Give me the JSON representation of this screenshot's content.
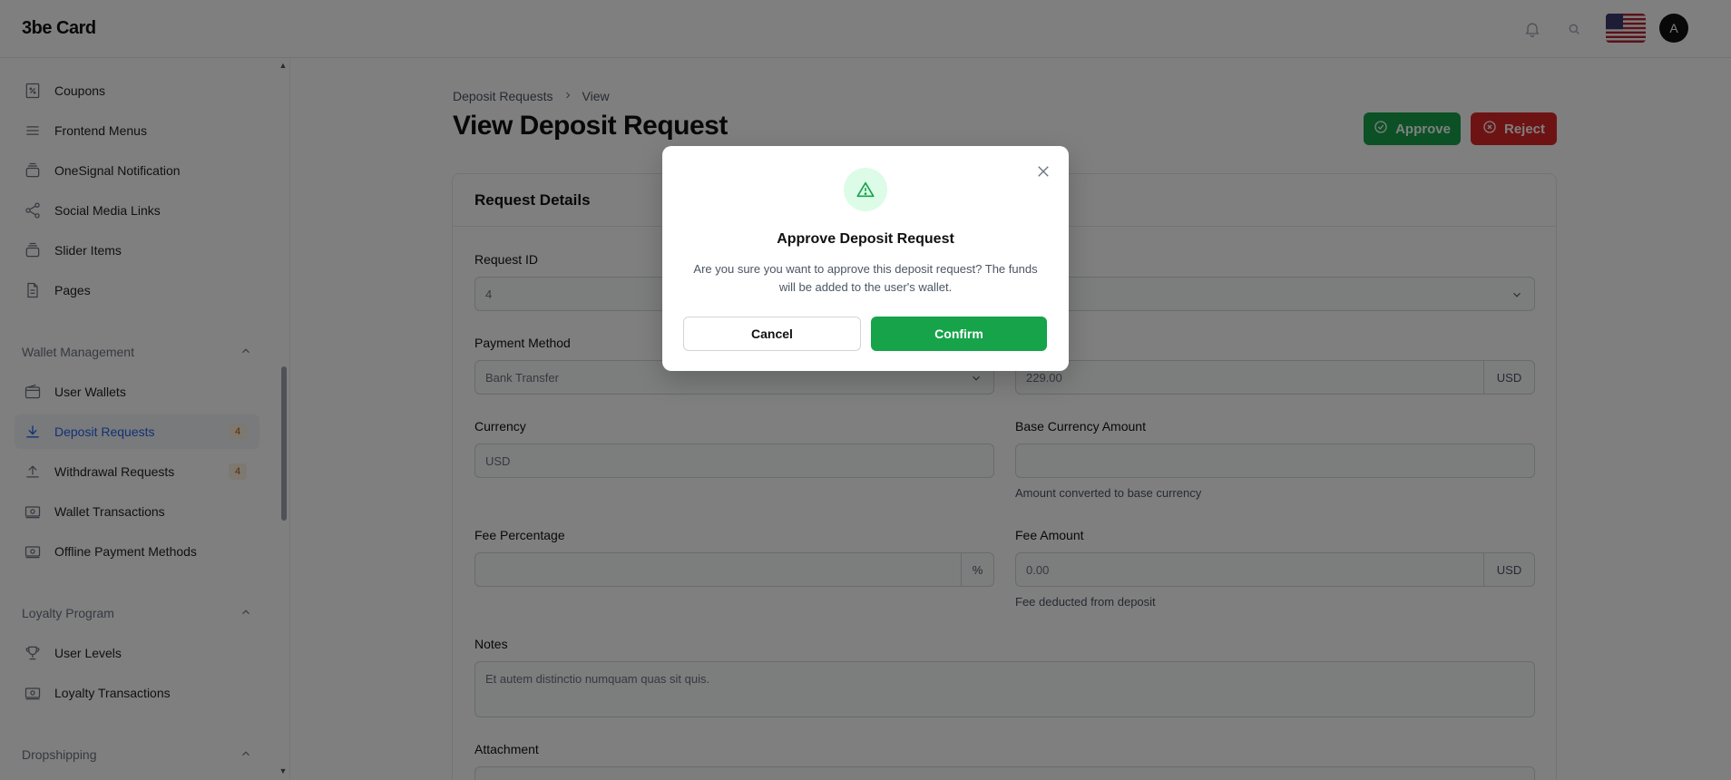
{
  "app": {
    "logo": "3be Card"
  },
  "header": {
    "icons": [
      "bell-icon",
      "search-icon",
      "us-flag",
      "avatar"
    ],
    "avatar_initial": "A"
  },
  "sidebar": {
    "items_top": [
      {
        "label": "Coupons",
        "icon": "coupon-icon"
      },
      {
        "label": "Frontend Menus",
        "icon": "menu-icon"
      },
      {
        "label": "OneSignal Notification",
        "icon": "stack-icon"
      },
      {
        "label": "Social Media Links",
        "icon": "share-icon"
      },
      {
        "label": "Slider Items",
        "icon": "stack-icon"
      },
      {
        "label": "Pages",
        "icon": "page-icon"
      }
    ],
    "sections": [
      {
        "title": "Wallet Management",
        "items": [
          {
            "label": "User Wallets",
            "icon": "wallet-icon"
          },
          {
            "label": "Deposit Requests",
            "icon": "download-icon",
            "badge": "4",
            "active": true
          },
          {
            "label": "Withdrawal Requests",
            "icon": "upload-icon",
            "badge": "4"
          },
          {
            "label": "Wallet Transactions",
            "icon": "cash-icon"
          },
          {
            "label": "Offline Payment Methods",
            "icon": "cash-icon"
          }
        ]
      },
      {
        "title": "Loyalty Program",
        "items": [
          {
            "label": "User Levels",
            "icon": "trophy-icon"
          },
          {
            "label": "Loyalty Transactions",
            "icon": "cash-icon"
          }
        ]
      },
      {
        "title": "Dropshipping",
        "items": []
      }
    ]
  },
  "main": {
    "breadcrumb": [
      "Deposit Requests",
      "View"
    ],
    "title": "View Deposit Request",
    "approve_label": "Approve",
    "reject_label": "Reject",
    "card_title": "Request Details",
    "fields": {
      "request_id": {
        "label": "Request ID",
        "value": "4"
      },
      "payment_method": {
        "label": "Payment Method",
        "value": "Bank Transfer"
      },
      "amount": {
        "value": "229.00",
        "suffix": "USD"
      },
      "currency": {
        "label": "Currency",
        "value": "USD"
      },
      "base_currency_amount": {
        "label": "Base Currency Amount",
        "value": "",
        "help": "Amount converted to base currency"
      },
      "fee_percentage": {
        "label": "Fee Percentage",
        "value": "",
        "suffix": "%"
      },
      "fee_amount": {
        "label": "Fee Amount",
        "value": "0.00",
        "suffix": "USD",
        "help": "Fee deducted from deposit"
      },
      "notes": {
        "label": "Notes",
        "value": "Et autem distinctio numquam quas sit quis."
      },
      "attachment": {
        "label": "Attachment"
      }
    }
  },
  "modal": {
    "title": "Approve Deposit Request",
    "text": "Are you sure you want to approve this deposit request? The funds will be added to the user's wallet.",
    "cancel_label": "Cancel",
    "confirm_label": "Confirm",
    "icon": "warning-icon"
  },
  "colors": {
    "accent": "#16a34a",
    "danger": "#dc2626",
    "active_link": "#2563eb",
    "badge_bg": "#fdf2e0",
    "badge_text": "#b45309"
  }
}
